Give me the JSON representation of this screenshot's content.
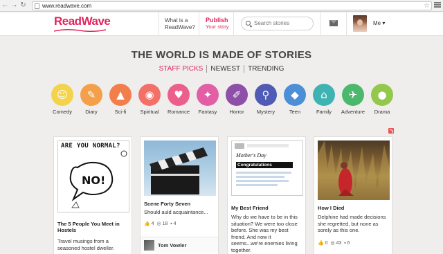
{
  "browser": {
    "url": "www.readwave.com"
  },
  "header": {
    "logo": "ReadWave",
    "what_is": "What is a ReadWave?",
    "publish": "Publish",
    "publish_sub": "Your story",
    "search_placeholder": "Search stories",
    "me": "Me ▾"
  },
  "hero": {
    "title": "THE WORLD IS MADE OF STORIES",
    "tabs": [
      "STAFF PICKS",
      "NEWEST",
      "TRENDING"
    ]
  },
  "categories": [
    {
      "label": "Comedy",
      "color": "#f3d34b",
      "icon": "smiley-icon",
      "glyph": "☺"
    },
    {
      "label": "Diary",
      "color": "#f4a04a",
      "icon": "pen-icon",
      "glyph": "✎"
    },
    {
      "label": "Sci-fi",
      "color": "#f27f4b",
      "icon": "rocket-icon",
      "glyph": "▲"
    },
    {
      "label": "Spiritual",
      "color": "#f27067",
      "icon": "eye-icon",
      "glyph": "◉"
    },
    {
      "label": "Romance",
      "color": "#ec5f8a",
      "icon": "heart-icon",
      "glyph": "♥"
    },
    {
      "label": "Fantasy",
      "color": "#e25fa6",
      "icon": "magic-wand-icon",
      "glyph": "✦"
    },
    {
      "label": "Horror",
      "color": "#8e4fa8",
      "icon": "knife-icon",
      "glyph": "✐"
    },
    {
      "label": "Mystery",
      "color": "#4f5bb4",
      "icon": "magnifier-icon",
      "glyph": "⚲"
    },
    {
      "label": "Teen",
      "color": "#4c8fd6",
      "icon": "football-icon",
      "glyph": "◆"
    },
    {
      "label": "Family",
      "color": "#3fb3b2",
      "icon": "house-icon",
      "glyph": "⌂"
    },
    {
      "label": "Adventure",
      "color": "#4cb86e",
      "icon": "airplane-icon",
      "glyph": "✈"
    },
    {
      "label": "Drama",
      "color": "#93c84d",
      "icon": "drop-icon",
      "glyph": "●"
    }
  ],
  "cards": [
    {
      "title": "The 5 People You Meet in Hostels",
      "desc": "Travel musings from a seasoned hostel dweller.",
      "art_text": "ARE YOU NORMAL?",
      "art_bubble": "NO!"
    },
    {
      "title": "Scene Forty Seven",
      "desc": "Should auld acquaintance...",
      "likes": "4",
      "views": "18",
      "comments": "4",
      "author": "Tom Vowler"
    },
    {
      "title": "My Best Friend",
      "desc": "Why do we have to be in this situation? We were too close before. She was my best friend. And now it seems...we're enemies living together.",
      "doc_heading": "Mother's Day",
      "doc_banner": "Congratulations"
    },
    {
      "title": "How I Died",
      "desc": "Delphine had made decisions she regretted, but none as sorely as this one.",
      "likes": "0",
      "views": "43",
      "comments": "6"
    }
  ]
}
